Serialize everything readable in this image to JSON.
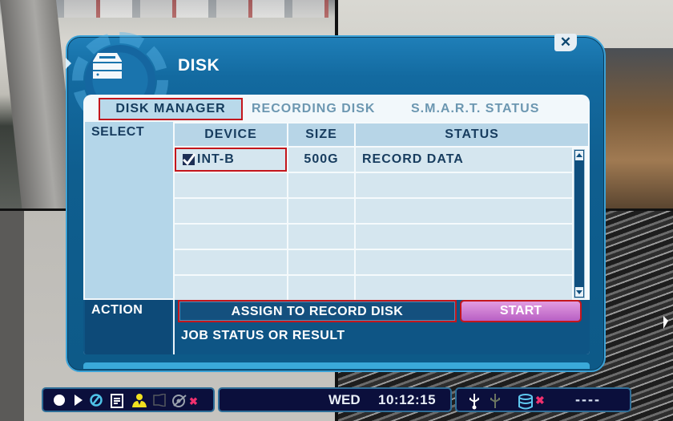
{
  "dialog": {
    "title": "DISK",
    "icon": "disk-drive-icon",
    "close_icon": "close-icon"
  },
  "tabs": [
    {
      "label": "DISK MANAGER",
      "active": true
    },
    {
      "label": "RECORDING DISK",
      "active": false
    },
    {
      "label": "S.M.A.R.T. STATUS",
      "active": false
    }
  ],
  "table": {
    "select_label": "SELECT",
    "headers": {
      "device": "DEVICE",
      "size": "SIZE",
      "status": "STATUS"
    },
    "rows": [
      {
        "checked": true,
        "device": "INT-B",
        "size": "500G",
        "status": "RECORD DATA"
      },
      {
        "checked": false,
        "device": "",
        "size": "",
        "status": ""
      },
      {
        "checked": false,
        "device": "",
        "size": "",
        "status": ""
      },
      {
        "checked": false,
        "device": "",
        "size": "",
        "status": ""
      },
      {
        "checked": false,
        "device": "",
        "size": "",
        "status": ""
      },
      {
        "checked": false,
        "device": "",
        "size": "",
        "status": ""
      }
    ]
  },
  "action": {
    "label": "ACTION",
    "selected_action": "ASSIGN TO RECORD DISK",
    "start_label": "START",
    "job_status": "JOB STATUS OR RESULT"
  },
  "status_bar": {
    "left_icons": [
      "record-icon",
      "play-icon",
      "no-entry-icon",
      "log-icon",
      "users-icon",
      "audio-off-icon",
      "network-off-icon",
      "error-x-icon"
    ],
    "day": "WED",
    "time": "10:12:15",
    "right_icons": [
      "usb-icon",
      "usb-inactive-icon",
      "database-icon",
      "error-x-icon"
    ],
    "right_text": "----"
  },
  "colors": {
    "dialog_blue": "#0f5e8f",
    "highlight_red": "#c4161c",
    "start_button": "#c977d2",
    "status_bar_bg": "#0b0f3c"
  }
}
